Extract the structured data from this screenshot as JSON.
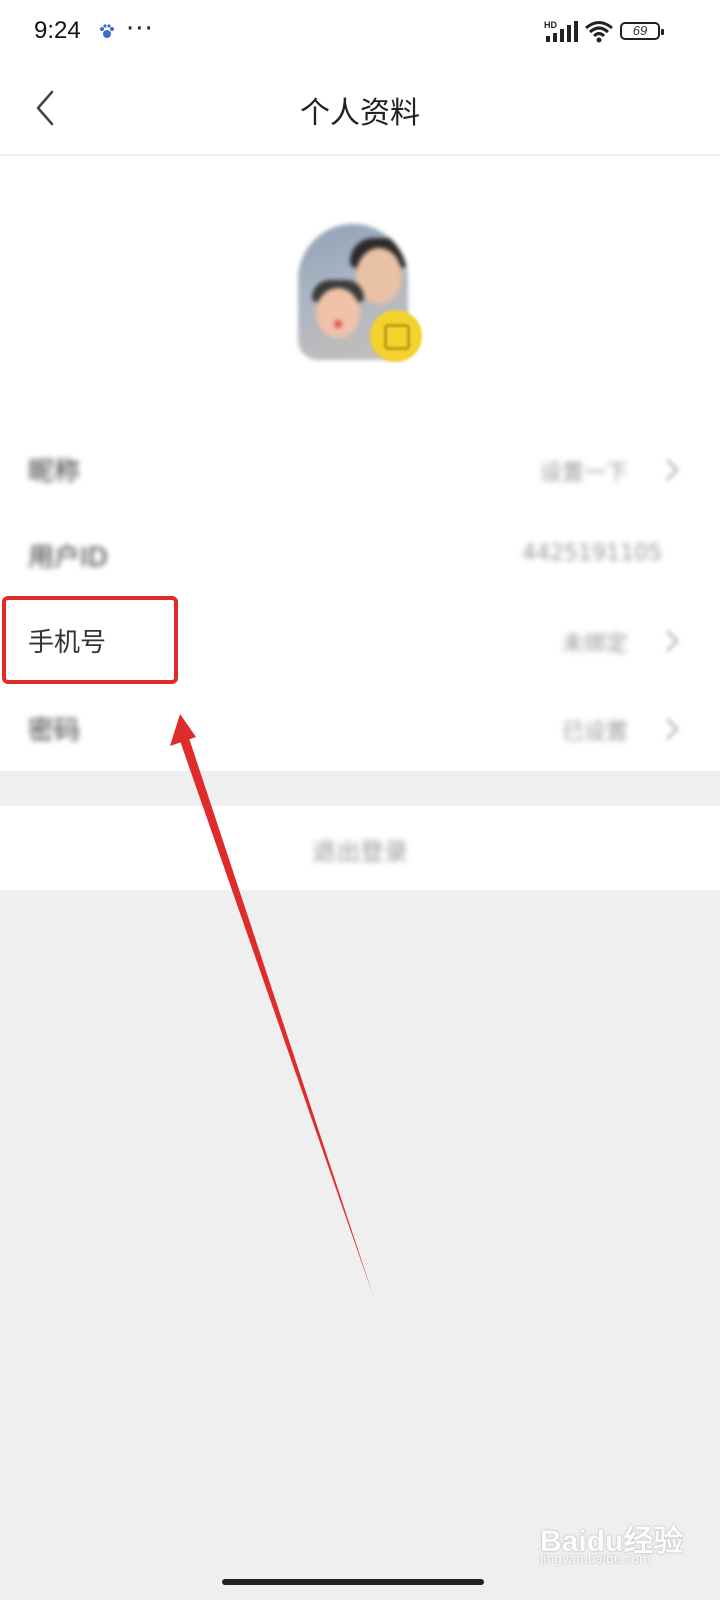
{
  "status_bar": {
    "time": "9:24",
    "more": "···",
    "signal_label": "HD",
    "battery": "69",
    "icons": [
      "baidu-paw-icon",
      "signal-icon",
      "wifi-icon",
      "battery-icon"
    ]
  },
  "nav": {
    "title": "个人资料",
    "back_icon": "chevron-left-icon"
  },
  "profile": {
    "rows": [
      {
        "label": "昵称",
        "value": "设置一下",
        "chevron": true
      },
      {
        "label": "用户ID",
        "value": "4425191105",
        "chevron": false
      },
      {
        "label": "手机号",
        "value": "未绑定",
        "chevron": true
      },
      {
        "label": "密码",
        "value": "已设置",
        "chevron": true
      }
    ]
  },
  "logout_label": "退出登录",
  "annotation": {
    "highlight_color": "#e02b2b",
    "arrow_color": "#e02b2b"
  },
  "watermark": {
    "brand": "Baidu经验",
    "url": "jingyan.baidu.com"
  }
}
